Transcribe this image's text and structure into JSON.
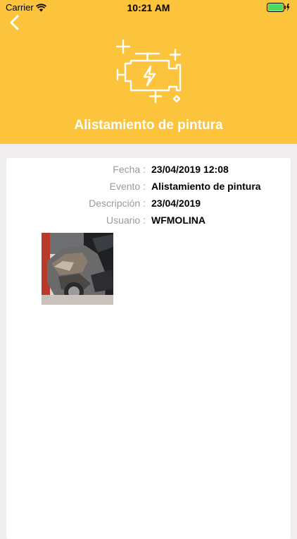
{
  "status_bar": {
    "carrier": "Carrier",
    "time": "10:21 AM"
  },
  "header": {
    "title": "Alistamiento de pintura",
    "icon": "engine-icon",
    "background_color": "#fcc33d"
  },
  "details": [
    {
      "label": "Fecha :",
      "value": "23/04/2019 12:08"
    },
    {
      "label": "Evento :",
      "value": "Alistamiento de pintura"
    },
    {
      "label": "Descripción :",
      "value": "23/04/2019"
    },
    {
      "label": "Usuario :",
      "value": "WFMOLINA"
    }
  ]
}
